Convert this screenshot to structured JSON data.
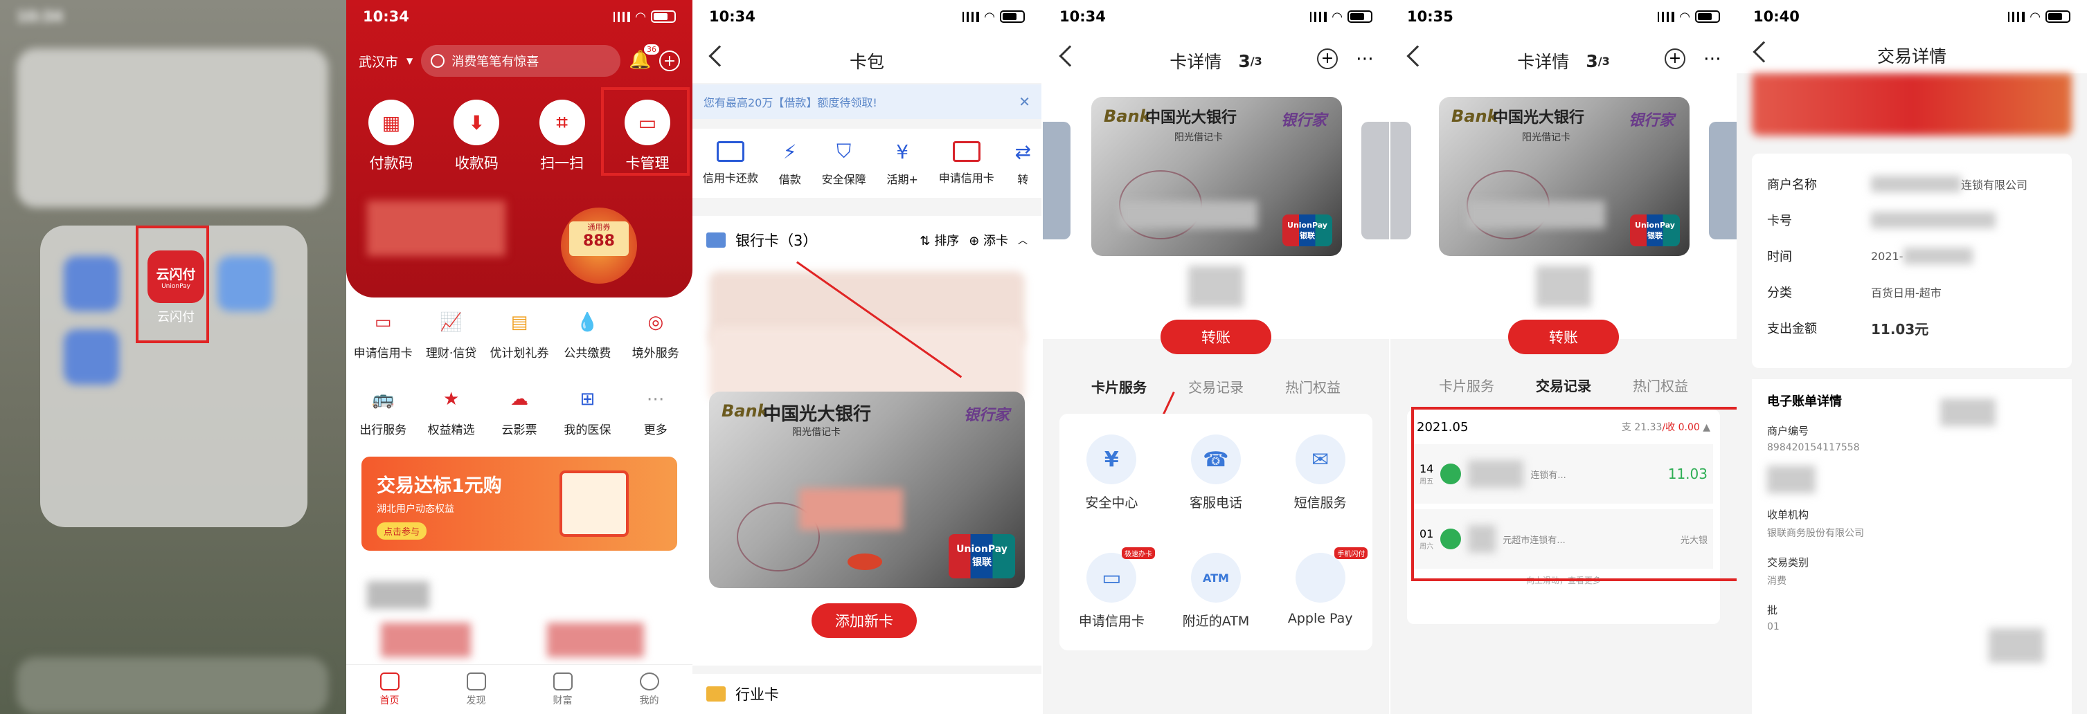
{
  "panel1": {
    "app_name": "云闪付",
    "app_logo_top": "云闪付",
    "app_logo_bottom": "UnionPay"
  },
  "panel2": {
    "time": "10:34",
    "city": "武汉市",
    "search_placeholder": "消费笔笔有惊喜",
    "notif_count": "36",
    "quick": [
      "付款码",
      "收款码",
      "扫一扫",
      "卡管理"
    ],
    "banner_tag": "通用券",
    "banner_amount": "888",
    "services": [
      "申请信用卡",
      "理财·信贷",
      "优计划礼券",
      "公共缴费",
      "境外服务",
      "出行服务",
      "权益精选",
      "云影票",
      "我的医保",
      "更多"
    ],
    "promo_title": "交易达标1元购",
    "promo_sub": "湖北用户动态权益",
    "promo_btn": "点击参与",
    "tabs": [
      "首页",
      "发现",
      "财富",
      "我的"
    ]
  },
  "panel3": {
    "time": "10:34",
    "title": "卡包",
    "notice": "您有最高20万【借款】额度待领取!",
    "shortcuts": [
      "信用卡还款",
      "借款",
      "安全保障",
      "活期+",
      "申请信用卡",
      "转"
    ],
    "section": "银行卡（3）",
    "sort": "排序",
    "add": "添卡",
    "bank": "中国光大银行",
    "bank_sub": "阳光借记卡",
    "card_brand": "Bank",
    "card_logo": "银行家",
    "unionpay_en": "UnionPay",
    "unionpay_cn": "银联",
    "add_btn": "添加新卡",
    "industry": "行业卡"
  },
  "panel4": {
    "time": "10:34",
    "title": "卡详情",
    "page": "3",
    "page_total": "/3",
    "transfer": "转账",
    "tabs": [
      "卡片服务",
      "交易记录",
      "热门权益"
    ],
    "services": [
      "安全中心",
      "客服电话",
      "短信服务",
      "申请信用卡",
      "附近的ATM",
      "Apple Pay"
    ],
    "badge1": "极速办卡",
    "badge2": "手机闪付",
    "atm_text": "ATM"
  },
  "panel5": {
    "time": "10:35",
    "title": "卡详情",
    "page": "3",
    "page_total": "/3",
    "transfer": "转账",
    "tabs": [
      "卡片服务",
      "交易记录",
      "热门权益"
    ],
    "month": "2021.05",
    "summary_out": "支 21.33",
    "summary_in": "/收 0.00",
    "rec1_day": "14",
    "rec1_week": "周五",
    "rec1_amount": "11.03",
    "rec1_desc": "连锁有...",
    "rec2_day": "01",
    "rec2_week": "周六",
    "rec2_desc": "元超市连锁有...",
    "rec2_bank": "光大银",
    "more": "— 向上滑动，查看更多 —"
  },
  "panel6": {
    "time": "10:40",
    "title": "交易详情",
    "merchant_label": "商户名称",
    "merchant_value": "连锁有限公司",
    "card_label": "卡号",
    "time_label": "时间",
    "time_value": "2021-",
    "cat_label": "分类",
    "cat_value": "百货日用-超市",
    "amount_label": "支出金额",
    "amount_value": "11.03元",
    "bill_title": "电子账单详情",
    "merchant_no_label": "商户编号",
    "merchant_no": "898420154117558",
    "acq_label": "收单机构",
    "acq_value": "银联商务股份有限公司",
    "type_label": "交易类别",
    "type_value": "消费",
    "batch_label": "批",
    "batch_value": "01"
  },
  "colors": {
    "accent": "#e02424",
    "brand_dark": "#b5151d",
    "notice_bg": "#e8f0fb",
    "page_bg": "#f4f4f4"
  }
}
